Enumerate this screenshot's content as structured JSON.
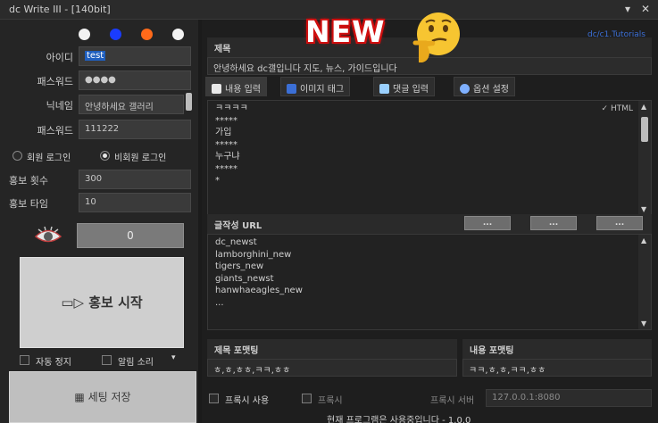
{
  "window": {
    "title": "dc Write III - [140bit]",
    "controls": [
      "▾",
      "✕"
    ]
  },
  "colors": {
    "dot1": "#f2f2f2",
    "dot2": "#1a3cff",
    "dot3": "#ff6a1a",
    "dot4": "#f2f2f2",
    "accent_link": "#3b6fd6",
    "new_badge": "#d01010"
  },
  "left": {
    "id_label": "아이디",
    "id_value": "test",
    "pw_label": "패스워드",
    "pw_value": "●●●●",
    "nick_label": "닉네임",
    "nick_value": "안녕하세요 갤러리",
    "pw2_label": "패스워드",
    "pw2_value": "111222",
    "radio_member": "회원 로그인",
    "radio_guest": "비회원 로그인",
    "count_label": "홍보 횟수",
    "count_value": "300",
    "delay_label": "홍보 타임",
    "delay_value": "10",
    "gray_button": "0",
    "start_button": "홍보 시작",
    "auto_stop": "자동 정지",
    "alarm": "알림 소리",
    "save_button": "세팅 저장"
  },
  "right": {
    "link_text": "dc/c1.Tutorials",
    "title_header": "제목",
    "title_value": "안녕하세요 dc갤입니다 지도, 뉴스, 가이드입니다",
    "tabs": [
      "내용 입력",
      "이미지 태그",
      "댓글 입력",
      "옵션 설정"
    ],
    "content_lines": [
      "ㅋㅋㅋㅋ",
      "*****",
      "가입",
      "*****",
      "누구냐",
      "*****",
      "*"
    ],
    "html_label": "✓ HTML",
    "url_header": "글작성 URL",
    "url_buttons": [
      "...",
      "...",
      "..."
    ],
    "url_lines": [
      "dc_newst",
      "lamborghini_new",
      "tigers_new",
      "giants_newst",
      "hanwhaeagles_new",
      "..."
    ],
    "title_sep_header": "제목 포맷팅",
    "title_sep_value": "ㅎ,ㅎ,ㅎㅎ,ㅋㅋ,ㅎㅎ",
    "content_sep_header": "내용 포맷팅",
    "content_sep_value": "ㅋㅋ,ㅎ,ㅎ,ㅋㅋ,ㅎㅎ",
    "proxy_use": "프록시 사용",
    "proxy_mode": "프록시",
    "proxy_addr_label": "프록시 서버",
    "proxy_addr_value": "127.0.0.1:8080",
    "footer": "현재 프로그램은 사용중입니다 - 1.0.0",
    "new_badge": "NEW"
  }
}
